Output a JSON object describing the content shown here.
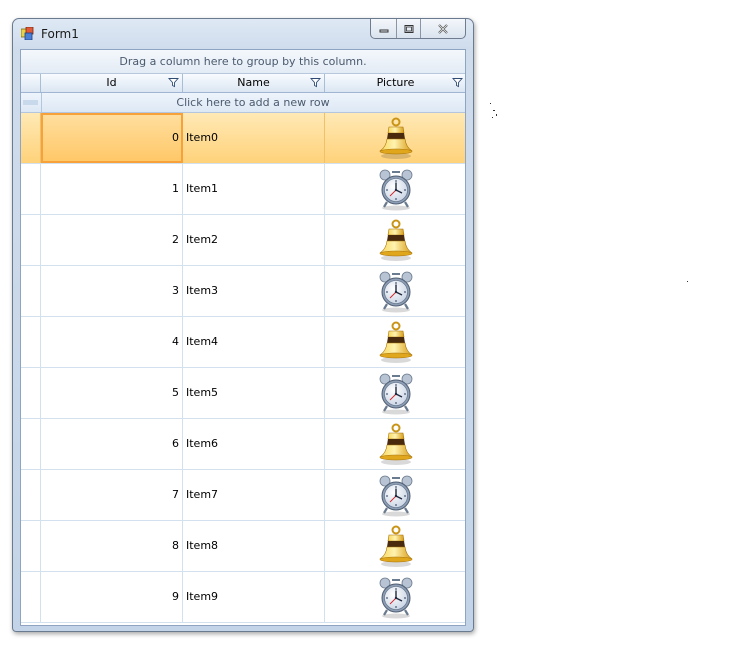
{
  "window": {
    "title": "Form1",
    "icons": {
      "app": "winforms-app-icon",
      "minimize": "minimize-icon",
      "maximize": "maximize-icon",
      "close": "close-icon"
    }
  },
  "grid": {
    "group_panel_text": "Drag a column here to group by this column.",
    "columns": [
      {
        "label": "Id",
        "filter_icon": "filter-icon"
      },
      {
        "label": "Name",
        "filter_icon": "filter-icon"
      },
      {
        "label": "Picture",
        "filter_icon": "filter-icon"
      }
    ],
    "new_row_text": "Click here to add a new row",
    "selected_row_index": 0,
    "rows": [
      {
        "id": "0",
        "name": "Item0",
        "picture": "bell-icon"
      },
      {
        "id": "1",
        "name": "Item1",
        "picture": "alarm-clock-icon"
      },
      {
        "id": "2",
        "name": "Item2",
        "picture": "bell-icon"
      },
      {
        "id": "3",
        "name": "Item3",
        "picture": "alarm-clock-icon"
      },
      {
        "id": "4",
        "name": "Item4",
        "picture": "bell-icon"
      },
      {
        "id": "5",
        "name": "Item5",
        "picture": "alarm-clock-icon"
      },
      {
        "id": "6",
        "name": "Item6",
        "picture": "bell-icon"
      },
      {
        "id": "7",
        "name": "Item7",
        "picture": "alarm-clock-icon"
      },
      {
        "id": "8",
        "name": "Item8",
        "picture": "bell-icon"
      },
      {
        "id": "9",
        "name": "Item9",
        "picture": "alarm-clock-icon"
      }
    ]
  },
  "colors": {
    "selection": "#ffd27a",
    "current_cell_border": "#f7a13b",
    "grid_line": "#d3e0ee",
    "header": "#dbe6f3"
  }
}
